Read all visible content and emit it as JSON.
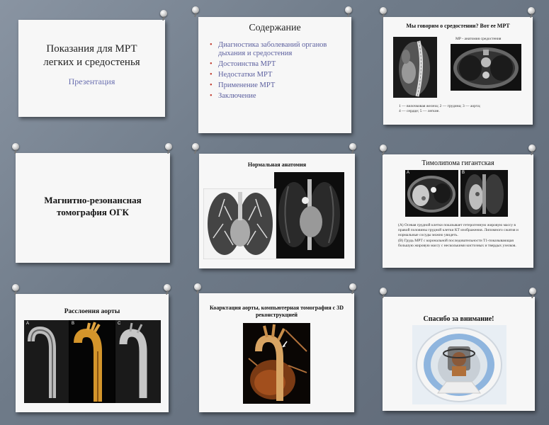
{
  "slides": [
    {
      "title_line1": "Показания для МРТ",
      "title_line2": "легких и средостенья",
      "subtitle": "Презентация"
    },
    {
      "heading": "Содержание",
      "items": [
        "Диагностика заболеваний органов дыхания и средостения",
        "Достоинства МРТ",
        "Недостатки МРТ",
        "Применение МРТ",
        "Заключение"
      ]
    },
    {
      "heading": "Мы говорим о средостении? Вот ее МРТ",
      "caption": "МР - анатомия средостения",
      "legend_line1": "1 — вилочковая железа; 2 — грудина; 3 — аорта;",
      "legend_line2": "4 — сердце; 5 — легкие."
    },
    {
      "title_line1": "Магнитно-резонансная",
      "title_line2": "томография ОГК"
    },
    {
      "heading": "Нормальная анатомия"
    },
    {
      "heading": "Тимолипома гигантская",
      "label_a": "A",
      "label_b": "B",
      "item_a": "(A) Осевая грудной клетки показывает гетерогенную жировую массу в правой половины грудной клетки КТ изображения. Липомного сжатия и нормальные сосуды можно увидеть.",
      "item_b": "(B) Грудь МРТ с корональной последовательности T1-показывающая большую жировую массу с несколькими кистозных и твердых узелков."
    },
    {
      "heading": "Расслоения аорты",
      "label_a": "A",
      "label_b": "B",
      "label_c": "C"
    },
    {
      "heading": "Коарктация аорты, компьютерная томография с 3D реконструкцией"
    },
    {
      "heading": "Спасибо за внимание!"
    }
  ]
}
